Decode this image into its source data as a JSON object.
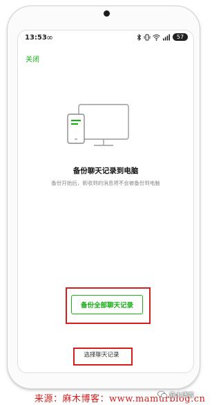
{
  "status_bar": {
    "time": "13:53",
    "loop_glyph": "∞",
    "battery": "57",
    "icons": [
      "bluetooth-icon",
      "vibrate-icon",
      "wifi-icon",
      "signal-icon"
    ]
  },
  "header": {
    "close_label": "关闭"
  },
  "main": {
    "title": "备份聊天记录到电脑",
    "subtitle": "备份开始后，新收到的消息将不会被备份到电脑"
  },
  "actions": {
    "backup_all_label": "备份全部聊天记录",
    "select_label": "选择聊天记录"
  },
  "footer": {
    "source_text": "来源：麻木博客：www.mamurblog.cn",
    "watermark": "麻木博客"
  },
  "colors": {
    "accent": "#1aad19",
    "annotation": "#d51d1d"
  }
}
